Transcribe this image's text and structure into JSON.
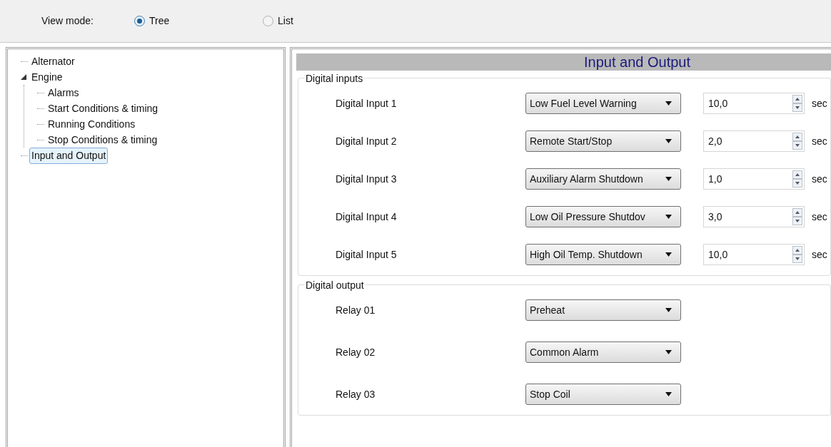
{
  "view_mode": {
    "label": "View mode:",
    "options": [
      {
        "label": "Tree",
        "selected": true
      },
      {
        "label": "List",
        "selected": false
      }
    ]
  },
  "tree": [
    {
      "label": "Alternator",
      "selected": false
    },
    {
      "label": "Engine",
      "selected": false,
      "expanded": true,
      "children": [
        {
          "label": "Alarms",
          "selected": false
        },
        {
          "label": "Start Conditions & timing",
          "selected": false
        },
        {
          "label": "Running Conditions",
          "selected": false
        },
        {
          "label": "Stop Conditions & timing",
          "selected": false
        }
      ]
    },
    {
      "label": "Input and Output",
      "selected": true
    }
  ],
  "panel": {
    "title": "Input and Output",
    "digital_inputs": {
      "legend": "Digital inputs",
      "rows": [
        {
          "label": "Digital Input 1",
          "function": "Low Fuel Level Warning",
          "delay": "10,0",
          "unit": "sec"
        },
        {
          "label": "Digital Input 2",
          "function": "Remote Start/Stop",
          "delay": "2,0",
          "unit": "sec"
        },
        {
          "label": "Digital Input 3",
          "function": "Auxiliary Alarm Shutdown",
          "delay": "1,0",
          "unit": "sec"
        },
        {
          "label": "Digital Input 4",
          "function": "Low Oil Pressure Shutdov",
          "delay": "3,0",
          "unit": "sec"
        },
        {
          "label": "Digital Input 5",
          "function": "High Oil Temp. Shutdown",
          "delay": "10,0",
          "unit": "sec"
        }
      ]
    },
    "digital_output": {
      "legend": "Digital output",
      "rows": [
        {
          "label": "Relay 01",
          "function": "Preheat"
        },
        {
          "label": "Relay 02",
          "function": "Common Alarm"
        },
        {
          "label": "Relay 03",
          "function": "Stop Coil"
        }
      ]
    }
  }
}
